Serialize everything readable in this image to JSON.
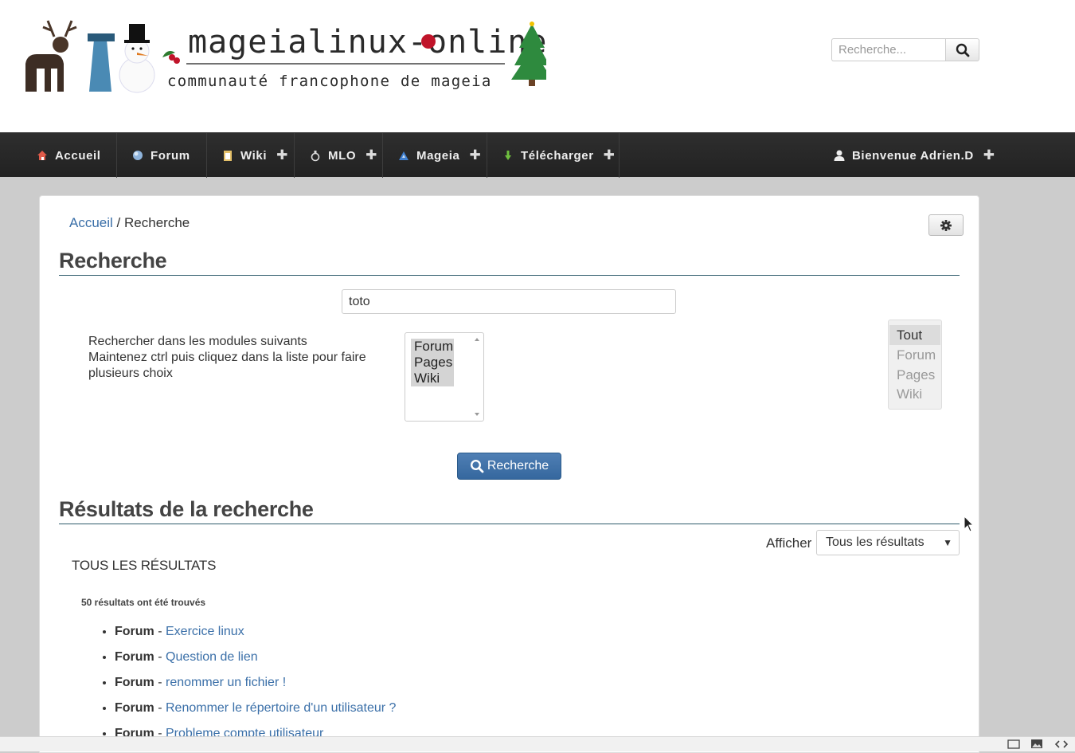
{
  "header": {
    "logo": {
      "title": "mageialinux-online",
      "subtitle": "communauté francophone de mageia"
    },
    "search": {
      "placeholder": "Recherche..."
    }
  },
  "nav": {
    "items": [
      {
        "label": "Accueil"
      },
      {
        "label": "Forum"
      },
      {
        "label": "Wiki"
      },
      {
        "label": "MLO"
      },
      {
        "label": "Mageia"
      },
      {
        "label": "Télécharger"
      }
    ],
    "user": {
      "label": "Bienvenue Adrien.D"
    }
  },
  "breadcrumb": {
    "home": "Accueil",
    "separator": "/",
    "current": "Recherche"
  },
  "search_section": {
    "title": "Recherche",
    "term": "toto",
    "modules_help_1": "Rechercher dans les modules suivants",
    "modules_help_2": "Maintenez ctrl puis cliquez dans la liste pour faire plusieurs choix",
    "modules": [
      "Forum",
      "Pages",
      "Wiki"
    ],
    "filters": [
      "Tout",
      "Forum",
      "Pages",
      "Wiki"
    ],
    "submit_label": "Recherche"
  },
  "results_section": {
    "title": "Résultats de la recherche",
    "show_label": "Afficher",
    "show_value": "Tous les résultats",
    "heading": "TOUS LES RÉSULTATS",
    "count_text": "50 résultats ont été trouvés",
    "items": [
      {
        "module": "Forum",
        "title": "Exercice linux"
      },
      {
        "module": "Forum",
        "title": "Question de lien"
      },
      {
        "module": "Forum",
        "title": "renommer un fichier !"
      },
      {
        "module": "Forum",
        "title": "Renommer le répertoire d'un utilisateur ?"
      },
      {
        "module": "Forum",
        "title": "Probleme compte utilisateur"
      }
    ]
  }
}
